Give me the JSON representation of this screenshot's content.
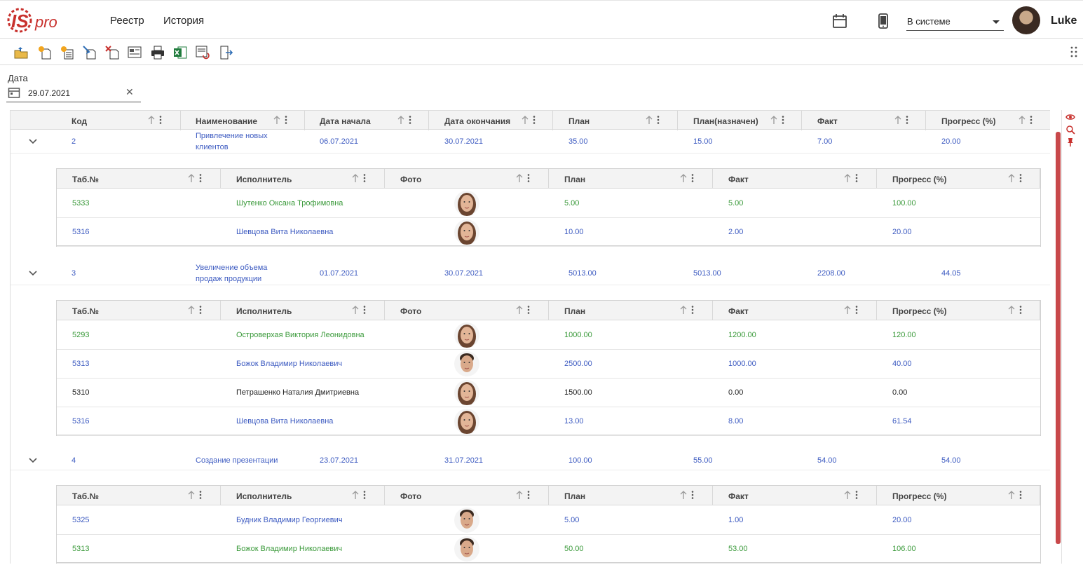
{
  "header": {
    "logo_text": "ISpro",
    "nav": [
      "Реестр",
      "История"
    ],
    "status_value": "В системе",
    "user_name": "Luke",
    "calendar_icon": "calendar-icon",
    "phone_icon": "mobile-phone-icon"
  },
  "toolbar": {
    "buttons": [
      "open-folder-icon",
      "new-document-icon",
      "new-list-icon",
      "edit-icon",
      "delete-icon",
      "report-icon",
      "print-icon",
      "excel-icon",
      "export-icon",
      "exit-icon"
    ]
  },
  "filter": {
    "date_label": "Дата",
    "date_value": "29.07.2021"
  },
  "master_columns": [
    "Код",
    "Наименование",
    "Дата начала",
    "Дата окончания",
    "План",
    "План(назначен)",
    "Факт",
    "Прогресс (%)"
  ],
  "sub_columns": [
    "Таб.№",
    "Исполнитель",
    "Фото",
    "План",
    "Факт",
    "Прогресс (%)"
  ],
  "groups": [
    {
      "code": "2",
      "name_line1": "Привлечение новых",
      "name_line2": "клиентов",
      "start": "06.07.2021",
      "end": "30.07.2021",
      "plan": "35.00",
      "plan_assigned": "15.00",
      "fact": "7.00",
      "progress": "20.00",
      "rows": [
        {
          "tab": "5333",
          "name": "Шутенко Оксана Трофимовна",
          "plan": "5.00",
          "fact": "5.00",
          "progress": "100.00",
          "color": "green",
          "gender": "f"
        },
        {
          "tab": "5316",
          "name": "Шевцова Вита Николаевна",
          "plan": "10.00",
          "fact": "2.00",
          "progress": "20.00",
          "color": "blue",
          "gender": "f"
        }
      ]
    },
    {
      "code": "3",
      "name_line1": "Увеличение объема",
      "name_line2": "продаж продукции",
      "start": "01.07.2021",
      "end": "30.07.2021",
      "plan": "5013.00",
      "plan_assigned": "5013.00",
      "fact": "2208.00",
      "progress": "44.05",
      "rows": [
        {
          "tab": "5293",
          "name": "Островерхая Виктория Леонидовна",
          "plan": "1000.00",
          "fact": "1200.00",
          "progress": "120.00",
          "color": "green",
          "gender": "f"
        },
        {
          "tab": "5313",
          "name": "Божок Владимир Николаевич",
          "plan": "2500.00",
          "fact": "1000.00",
          "progress": "40.00",
          "color": "blue",
          "gender": "m"
        },
        {
          "tab": "5310",
          "name": "Петрашенко Наталия Дмитриевна",
          "plan": "1500.00",
          "fact": "0.00",
          "progress": "0.00",
          "color": "black",
          "gender": "f"
        },
        {
          "tab": "5316",
          "name": "Шевцова Вита Николаевна",
          "plan": "13.00",
          "fact": "8.00",
          "progress": "61.54",
          "color": "blue",
          "gender": "f"
        }
      ]
    },
    {
      "code": "4",
      "name_line1": "Создание презентации",
      "name_line2": "",
      "start": "23.07.2021",
      "end": "31.07.2021",
      "plan": "100.00",
      "plan_assigned": "55.00",
      "fact": "54.00",
      "progress": "54.00",
      "rows": [
        {
          "tab": "5325",
          "name": "Будник Владимир Георгиевич",
          "plan": "5.00",
          "fact": "1.00",
          "progress": "20.00",
          "color": "blue",
          "gender": "m"
        },
        {
          "tab": "5313",
          "name": "Божок Владимир Николаевич",
          "plan": "50.00",
          "fact": "53.00",
          "progress": "106.00",
          "color": "green",
          "gender": "m"
        }
      ]
    }
  ],
  "colors": {
    "accent_red": "#c8484a",
    "link_blue": "#3d5bc1",
    "ok_green": "#3b9a3b"
  }
}
